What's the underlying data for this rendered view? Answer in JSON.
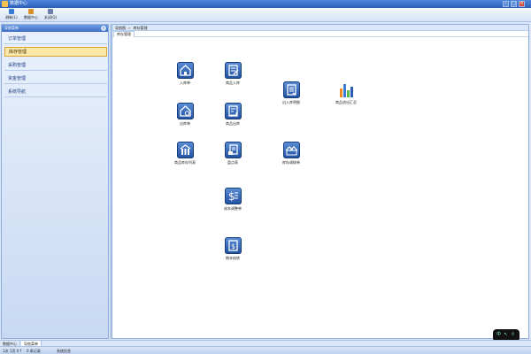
{
  "window": {
    "title": "数据中心"
  },
  "toolbar": [
    {
      "label": "刷新(L)",
      "color": "#3a7bd5"
    },
    {
      "label": "数据中心",
      "color": "#d9902b"
    },
    {
      "label": "关闭(Q)",
      "color": "#6b7fa8"
    }
  ],
  "sidebar": {
    "header": "导航菜单",
    "collapse_glyph": "«",
    "items": [
      {
        "label": "订单管理",
        "active": false
      },
      {
        "label": "库存管理",
        "active": true
      },
      {
        "label": "采购管理",
        "active": false
      },
      {
        "label": "资金管理",
        "active": false
      },
      {
        "label": "系统导航",
        "active": false
      }
    ]
  },
  "main": {
    "breadcrumb": [
      "导航图",
      "库存管理"
    ],
    "breadcrumb_sep": "»",
    "tab": "库存管理",
    "nodes": [
      {
        "label": "入库单",
        "icon": "inbound-home-icon"
      },
      {
        "label": "商品入库",
        "icon": "goods-in-icon"
      },
      {
        "label": "出库单",
        "icon": "outbound-home-icon"
      },
      {
        "label": "商品出库",
        "icon": "goods-out-icon"
      },
      {
        "label": "商品库存列表",
        "icon": "warehouse-icon"
      },
      {
        "label": "盘点表",
        "icon": "inventory-check-icon"
      },
      {
        "label": "出入库明细",
        "icon": "in-out-detail-icon"
      },
      {
        "label": "库存调拨单",
        "icon": "transfer-icon"
      },
      {
        "label": "成本调整单",
        "icon": "cost-adjust-icon"
      },
      {
        "label": "期末结转",
        "icon": "period-close-icon"
      },
      {
        "label": "商品进出汇总",
        "icon": "bar-chart-icon"
      }
    ],
    "floatbar_glyphs": [
      "中",
      "↖",
      "⇧"
    ]
  },
  "bottom_tabs": [
    {
      "label": "数据中心",
      "active": false
    },
    {
      "label": "导航菜单",
      "active": true
    }
  ],
  "status": {
    "left": "1次 1页 0 f",
    "middle": "0 条记录",
    "right": "系统信息"
  }
}
